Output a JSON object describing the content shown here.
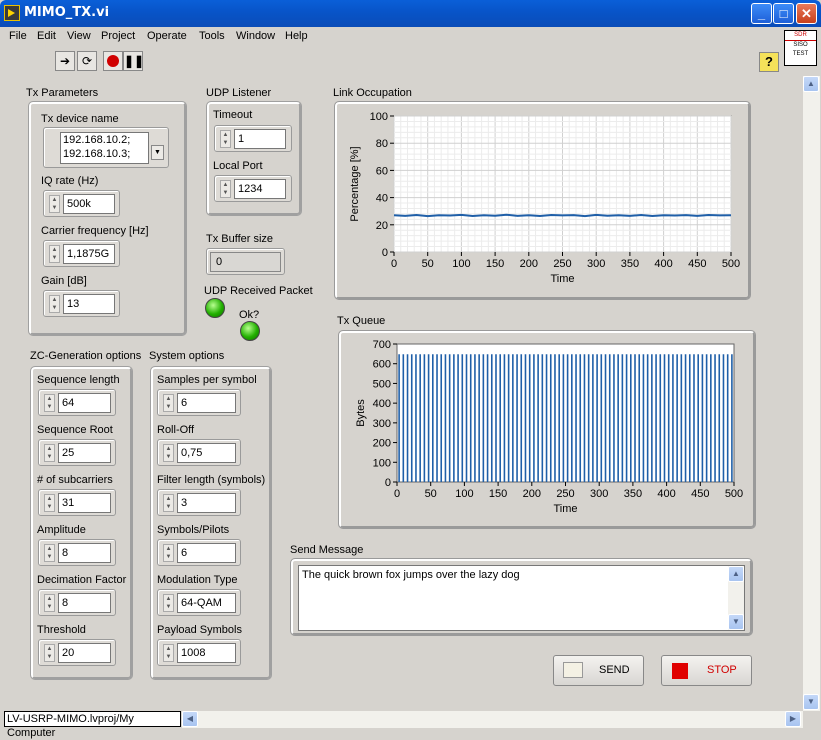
{
  "window": {
    "title": "MIMO_TX.vi"
  },
  "menu": [
    "File",
    "Edit",
    "View",
    "Project",
    "Operate",
    "Tools",
    "Window",
    "Help"
  ],
  "sdr_icon": {
    "line1": "SDR",
    "line2": "SISO",
    "line3": "TEST"
  },
  "tx_params": {
    "title": "Tx Parameters",
    "device_label": "Tx device name",
    "device_line1": "192.168.10.2;",
    "device_line2": "192.168.10.3;",
    "iq_label": "IQ rate (Hz)",
    "iq_value": "500k",
    "carrier_label": "Carrier frequency [Hz]",
    "carrier_value": "1,1875G",
    "gain_label": "Gain [dB]",
    "gain_value": "13"
  },
  "udp": {
    "title": "UDP Listener",
    "timeout_label": "Timeout",
    "timeout_value": "1",
    "port_label": "Local Port",
    "port_value": "1234"
  },
  "tx_buffer": {
    "label": "Tx Buffer size",
    "value": "0"
  },
  "udp_received_label": "UDP Received Packet",
  "ok_label": "Ok?",
  "zc": {
    "title": "ZC-Generation options",
    "items": [
      {
        "label": "Sequence length",
        "value": "64"
      },
      {
        "label": "Sequence Root",
        "value": "25"
      },
      {
        "label": "# of subcarriers",
        "value": "31"
      },
      {
        "label": "Amplitude",
        "value": "8"
      },
      {
        "label": "Decimation Factor",
        "value": "8"
      },
      {
        "label": "Threshold",
        "value": "20"
      }
    ]
  },
  "sys": {
    "title": "System options",
    "items": [
      {
        "label": "Samples per symbol",
        "value": "6"
      },
      {
        "label": "Roll-Off",
        "value": "0,75"
      },
      {
        "label": "Filter length (symbols)",
        "value": "3"
      },
      {
        "label": "Symbols/Pilots",
        "value": "6"
      },
      {
        "label": "Modulation Type",
        "value": "64-QAM"
      },
      {
        "label": "Payload Symbols",
        "value": "1008"
      }
    ]
  },
  "send_message": {
    "label": "Send Message",
    "text": "The quick brown fox jumps over the lazy dog"
  },
  "buttons": {
    "send": "SEND",
    "stop": "STOP"
  },
  "status_path": "LV-USRP-MIMO.lvproj/My Computer",
  "colors": {
    "trace": "#1f5fa8",
    "led_on": "#22b000",
    "stop": "#e00000"
  },
  "chart_data": [
    {
      "type": "line",
      "title": "Link Occupation",
      "xlabel": "Time",
      "ylabel": "Percentage [%]",
      "xlim": [
        0,
        500
      ],
      "ylim": [
        0,
        100
      ],
      "x_ticks": [
        "0",
        "50",
        "100",
        "150",
        "200",
        "250",
        "300",
        "350",
        "400",
        "450",
        "500"
      ],
      "y_ticks": [
        "0",
        "20",
        "40",
        "60",
        "80",
        "100"
      ],
      "grid": true,
      "series": [
        {
          "values": [
            27,
            26.6,
            27.2,
            26.4,
            27,
            26.8,
            27.3,
            26.5,
            27,
            26.7,
            27.4,
            26.6,
            27,
            26.5,
            27.2,
            26.9,
            27.1,
            26.4,
            27.3,
            26.7,
            27,
            26.6,
            27.2,
            26.5,
            27,
            26.8,
            27.1,
            26.6,
            27.2,
            26.9,
            27
          ]
        }
      ]
    },
    {
      "type": "bar",
      "title": "Tx Queue",
      "xlabel": "Time",
      "ylabel": "Bytes",
      "xlim": [
        0,
        500
      ],
      "ylim": [
        0,
        700
      ],
      "x_ticks": [
        "0",
        "50",
        "100",
        "150",
        "200",
        "250",
        "300",
        "350",
        "400",
        "450",
        "500"
      ],
      "y_ticks": [
        "0",
        "100",
        "200",
        "300",
        "400",
        "500",
        "600",
        "700"
      ],
      "grid": false,
      "pulse_value": 648,
      "pulse_count": 80
    }
  ]
}
